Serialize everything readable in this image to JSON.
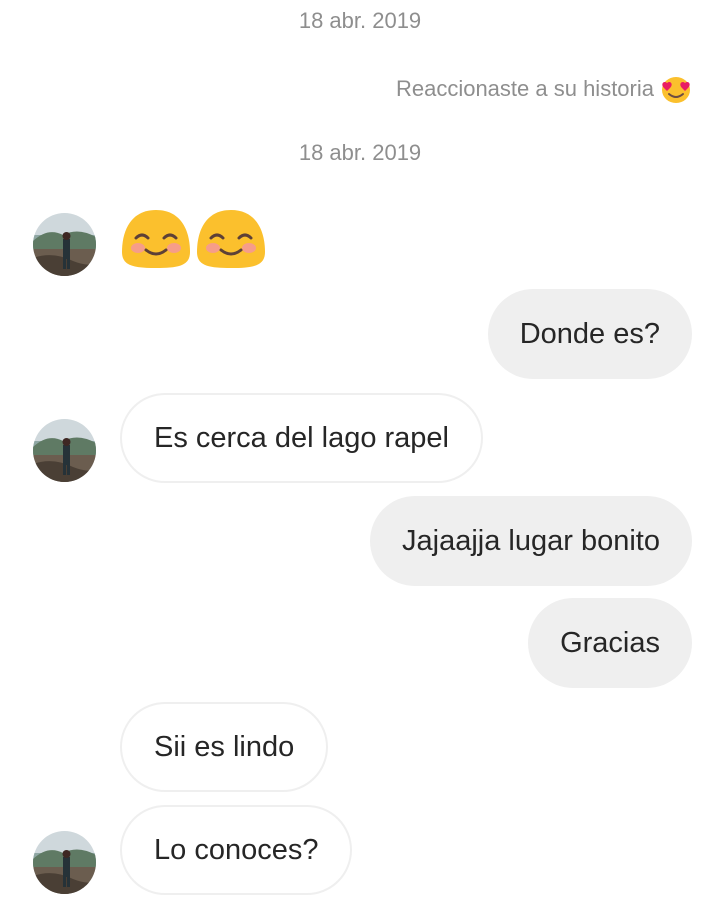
{
  "dates": [
    "18 abr. 2019",
    "18 abr. 2019"
  ],
  "story_reaction": {
    "text": "Reaccionaste a su historia",
    "emoji": "heart-eyes-emoji"
  },
  "emoji_message": {
    "emojis": [
      "smiling-emoji",
      "smiling-emoji"
    ]
  },
  "messages": [
    {
      "direction": "outgoing",
      "text": "Donde es?"
    },
    {
      "direction": "incoming",
      "text": "Es cerca del lago rapel"
    },
    {
      "direction": "outgoing",
      "text": "Jajaajja lugar bonito"
    },
    {
      "direction": "outgoing",
      "text": "Gracias"
    },
    {
      "direction": "incoming",
      "text": "Sii es lindo"
    },
    {
      "direction": "incoming",
      "text": "Lo conoces?"
    }
  ],
  "colors": {
    "outgoing_bubble": "#efefef",
    "incoming_border": "#efefef",
    "text": "#262626",
    "meta_text": "#8e8e8e",
    "emoji_yellow": "#fbc02d"
  }
}
